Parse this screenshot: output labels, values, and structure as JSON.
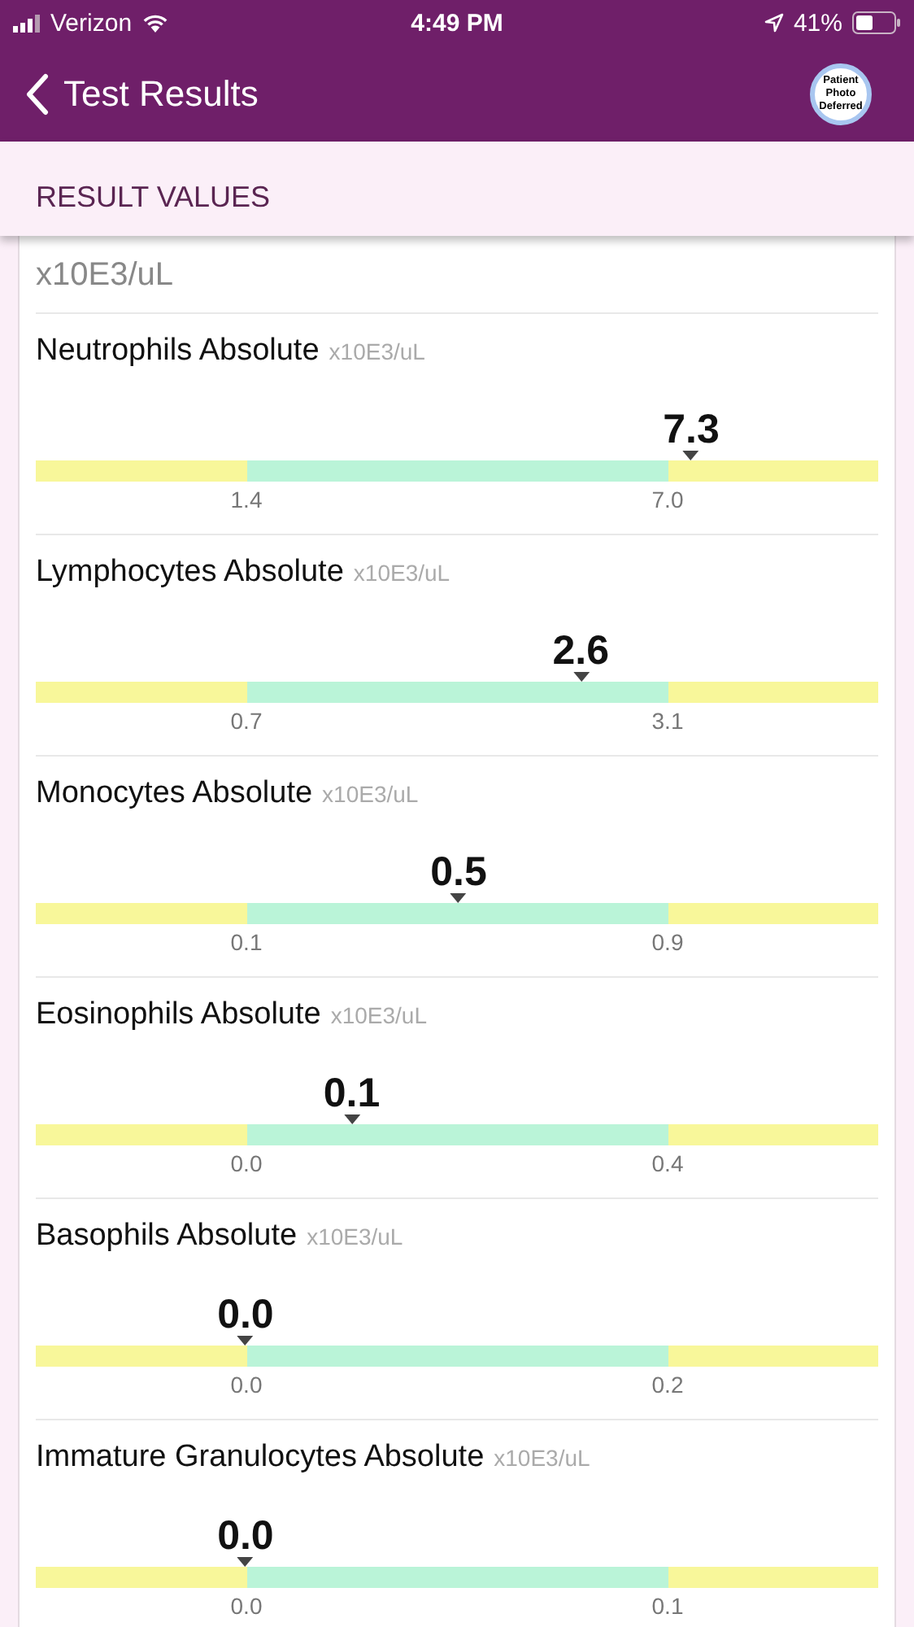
{
  "status_bar": {
    "carrier": "Verizon",
    "time": "4:49 PM",
    "battery": "41%"
  },
  "nav": {
    "back_label": "Test Results",
    "avatar_text": "Patient Photo Deferred"
  },
  "section": {
    "title": "RESULT VALUES"
  },
  "partial_row": {
    "unit": "x10E3/uL"
  },
  "results": [
    {
      "name": "Neutrophils Absolute",
      "unit": "x10E3/uL",
      "value": "7.3",
      "level": 0.778,
      "low": "1.4",
      "high": "7.0"
    },
    {
      "name": "Lymphocytes Absolute",
      "unit": "x10E3/uL",
      "value": "2.6",
      "level": 0.647,
      "low": "0.7",
      "high": "3.1"
    },
    {
      "name": "Monocytes Absolute",
      "unit": "x10E3/uL",
      "value": "0.5",
      "level": 0.502,
      "low": "0.1",
      "high": "0.9"
    },
    {
      "name": "Eosinophils Absolute",
      "unit": "x10E3/uL",
      "value": "0.1",
      "level": 0.375,
      "low": "0.0",
      "high": "0.4"
    },
    {
      "name": "Basophils Absolute",
      "unit": "x10E3/uL",
      "value": "0.0",
      "level": 0.249,
      "low": "0.0",
      "high": "0.2"
    },
    {
      "name": "Immature Granulocytes Absolute",
      "unit": "x10E3/uL",
      "value": "0.0",
      "level": 0.249,
      "low": "0.0",
      "high": "0.1"
    }
  ]
}
